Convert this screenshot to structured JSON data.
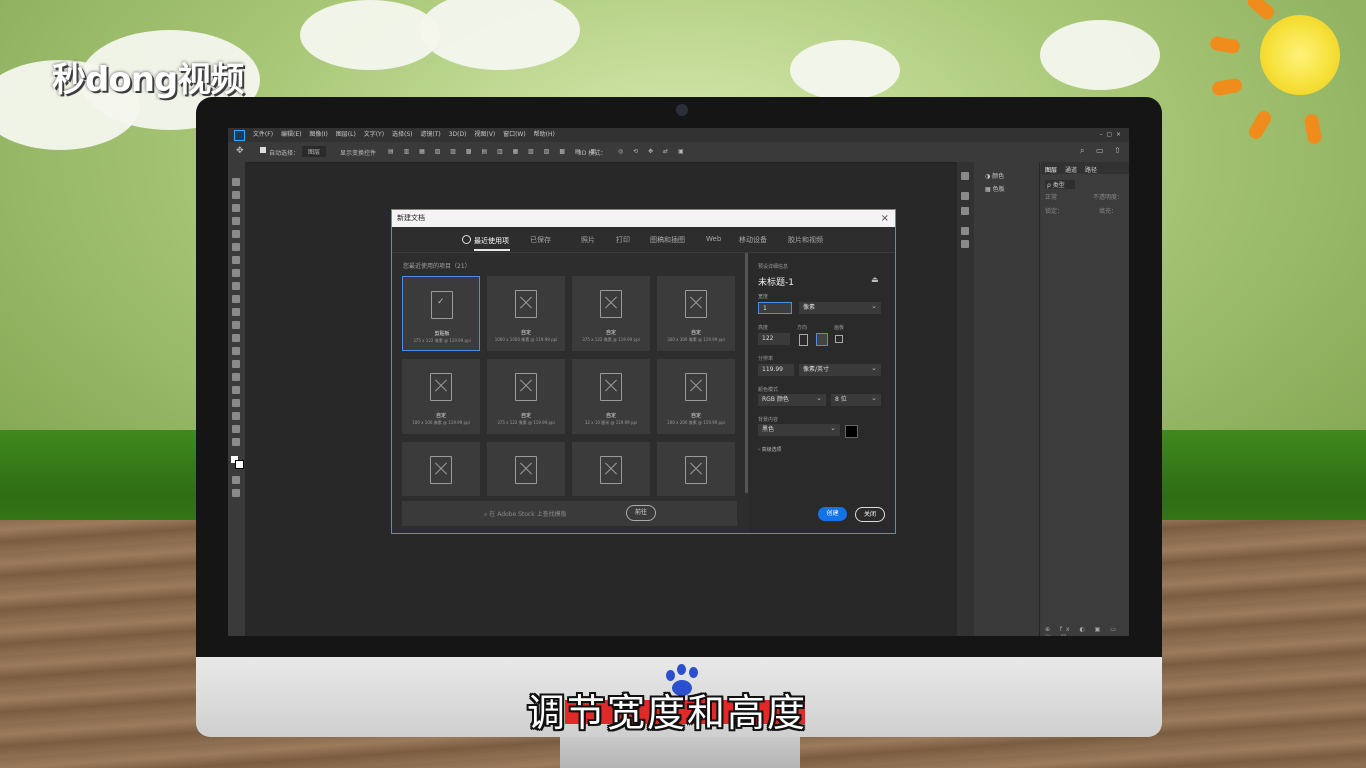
{
  "watermark_logo": "秒dong视频",
  "caption": "调节宽度和高度",
  "photoshop": {
    "menu": [
      "文件(F)",
      "编辑(E)",
      "图像(I)",
      "图层(L)",
      "文字(Y)",
      "选择(S)",
      "滤镜(T)",
      "3D(D)",
      "视图(V)",
      "窗口(W)",
      "帮助(H)"
    ],
    "options": {
      "auto_select": "自动选择：",
      "layer": "图层",
      "show_transform": "显示变换控件",
      "mode_3d": "3D 模式："
    },
    "right_panel": {
      "tab_color": "颜色",
      "tab_swatches": "色板",
      "tab_layers": "图层",
      "tab_channels": "通道",
      "tab_paths": "路径",
      "kind": "ρ 类型",
      "normal": "正常",
      "opacity": "不透明度：",
      "lock": "锁定：",
      "fill": "填充："
    }
  },
  "dialog": {
    "title": "新建文档",
    "close": "×",
    "tabs": [
      "最近使用项",
      "已保存",
      "照片",
      "打印",
      "图稿和插图",
      "Web",
      "移动设备",
      "胶片和视频"
    ],
    "recent_label": "您最近使用的项目（21）",
    "tiles": [
      {
        "name": "剪贴板",
        "sub": "375 x 122 像素 @ 119.99 ppi"
      },
      {
        "name": "自定",
        "sub": "1000 x 1000 像素 @ 119.99 ppi"
      },
      {
        "name": "自定",
        "sub": "375 x 122 像素 @ 119.99 ppi"
      },
      {
        "name": "自定",
        "sub": "300 x 300 像素 @ 119.99 ppi"
      },
      {
        "name": "自定",
        "sub": "100 x 100 像素 @ 119.99 ppi"
      },
      {
        "name": "自定",
        "sub": "375 x 122 像素 @ 119.99 ppi"
      },
      {
        "name": "自定",
        "sub": "32 x 10 厘米 @ 119.99 ppi"
      },
      {
        "name": "自定",
        "sub": "200 x 200 像素 @ 119.99 ppi"
      },
      {
        "name": "",
        "sub": ""
      },
      {
        "name": "",
        "sub": ""
      },
      {
        "name": "",
        "sub": ""
      },
      {
        "name": "",
        "sub": ""
      }
    ],
    "search_placeholder": "在 Adobe Stock 上查找模板",
    "goto_button": "前往",
    "preset": {
      "details_label": "预设详细信息",
      "doc_name": "未标题-1",
      "width_label": "宽度",
      "width_value": "1",
      "width_unit": "像素",
      "height_label": "高度",
      "height_value": "122",
      "orientation_label": "方向",
      "artboard_label": "画板",
      "resolution_label": "分辨率",
      "resolution_value": "119.99",
      "resolution_unit": "像素/英寸",
      "color_mode_label": "颜色模式",
      "color_mode": "RGB 颜色",
      "bit_depth": "8 位",
      "bg_label": "背景内容",
      "bg_value": "黑色",
      "advanced": "› 高级选项"
    },
    "create_button": "创建",
    "close_button": "关闭"
  }
}
